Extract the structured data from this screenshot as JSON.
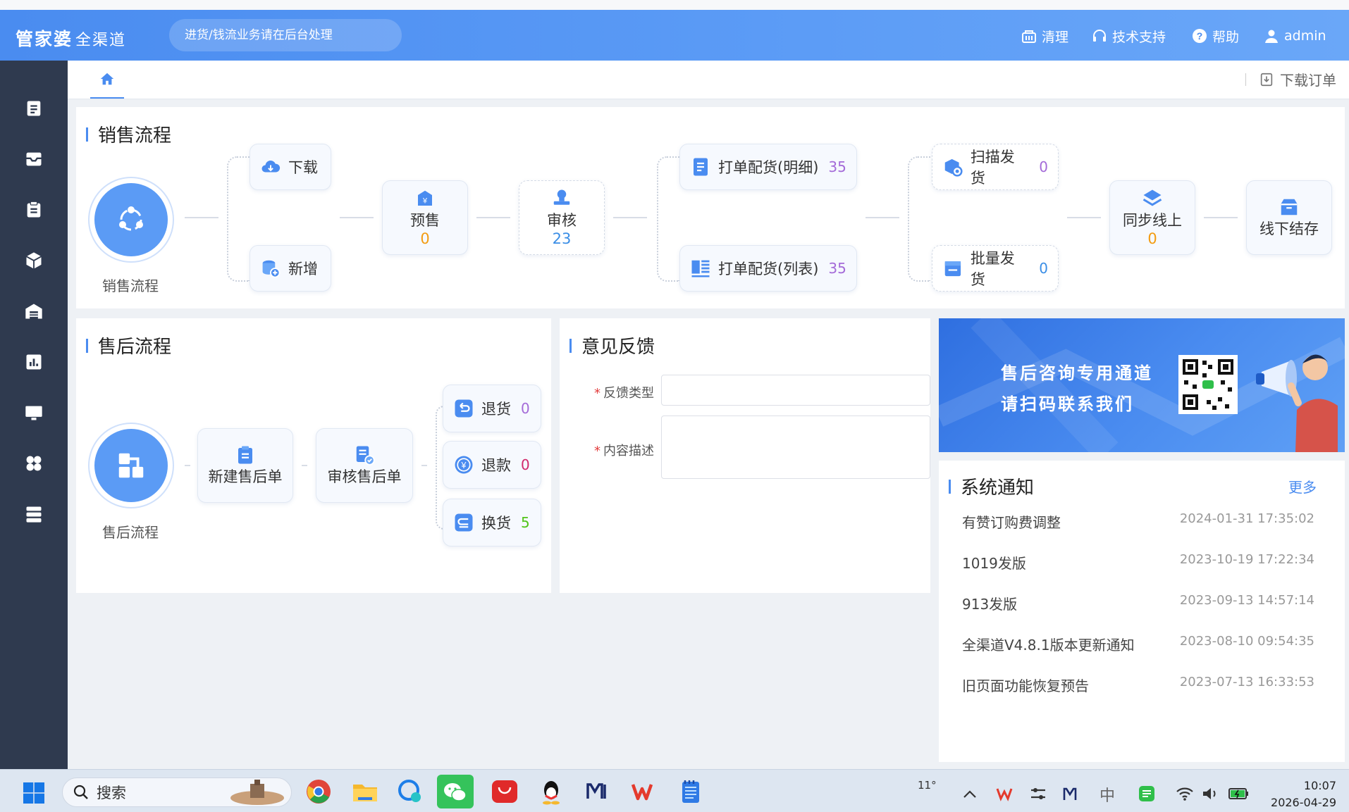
{
  "header": {
    "logo_main": "管家婆",
    "logo_sub": "全渠道",
    "notice": "进货/钱流业务请在后台处理",
    "actions": {
      "clean": "清理",
      "support": "技术支持",
      "help": "帮助",
      "user": "admin"
    }
  },
  "tabs": {
    "download_order": "下载订单"
  },
  "sales": {
    "title": "销售流程",
    "circle_label": "销售流程",
    "download": "下载",
    "add": "新增",
    "presale": {
      "label": "预售",
      "count": "0"
    },
    "audit": {
      "label": "审核",
      "count": "23"
    },
    "print_detail": {
      "label": "打单配货(明细)",
      "count": "35"
    },
    "print_list": {
      "label": "打单配货(列表)",
      "count": "35"
    },
    "scan_ship": {
      "label": "扫描发货",
      "count": "0"
    },
    "batch_ship": {
      "label": "批量发货",
      "count": "0"
    },
    "sync_online": {
      "label": "同步线上",
      "count": "0"
    },
    "offline_settle": {
      "label": "线下结存"
    }
  },
  "aftersale": {
    "title": "售后流程",
    "circle_label": "售后流程",
    "new_order": "新建售后单",
    "audit_order": "审核售后单",
    "return_goods": {
      "label": "退货",
      "count": "0"
    },
    "refund": {
      "label": "退款",
      "count": "0"
    },
    "exchange": {
      "label": "换货",
      "count": "5"
    }
  },
  "feedback": {
    "title": "意见反馈",
    "type_label": "反馈类型",
    "content_label": "内容描述"
  },
  "banner": {
    "line1": "售后咨询专用通道",
    "line2": "请扫码联系我们"
  },
  "notices": {
    "title": "系统通知",
    "more": "更多",
    "items": [
      {
        "title": "有赞订购费调整",
        "date": "2024-01-31 17:35:02"
      },
      {
        "title": "1019发版",
        "date": "2023-10-19 17:22:34"
      },
      {
        "title": "913发版",
        "date": "2023-09-13 14:57:14"
      },
      {
        "title": "全渠道V4.8.1版本更新通知",
        "date": "2023-08-10 09:54:35"
      },
      {
        "title": "旧页面功能恢复预告",
        "date": "2023-07-13 16:33:53"
      }
    ]
  },
  "taskbar": {
    "search": "搜索",
    "weather": "11°",
    "ime": "中",
    "time": "10:07",
    "date": "2026-04-29"
  }
}
